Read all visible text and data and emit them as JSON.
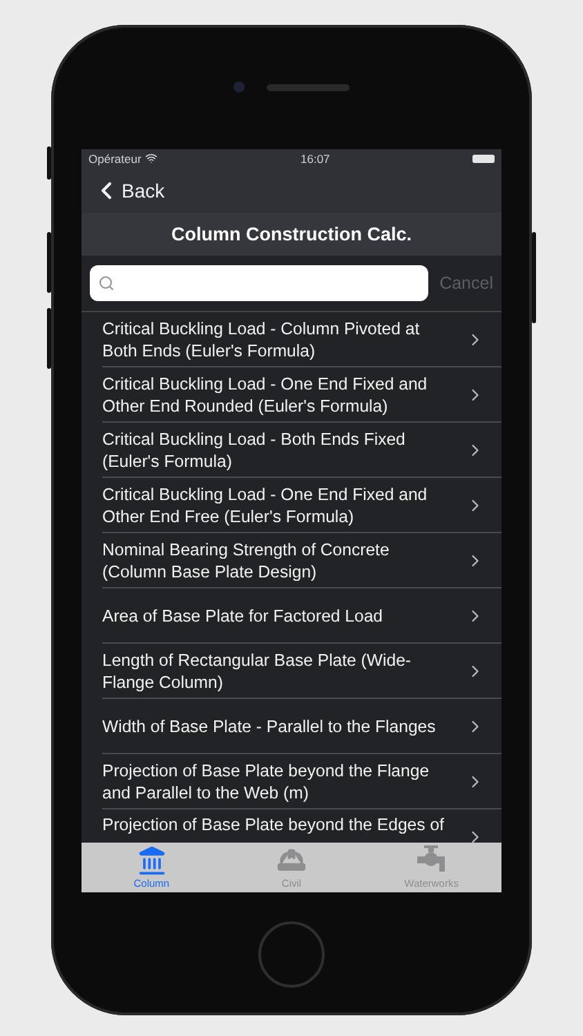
{
  "status_bar": {
    "carrier": "Opérateur",
    "time": "16:07"
  },
  "nav": {
    "back": "Back",
    "title": "Column Construction Calc."
  },
  "search": {
    "cancel": "Cancel"
  },
  "rows": [
    {
      "label": "Critical Buckling Load - Column Pivoted at Both Ends (Euler's Formula)"
    },
    {
      "label": "Critical Buckling Load - One End Fixed and Other End Rounded (Euler's Formula)"
    },
    {
      "label": "Critical Buckling Load - Both Ends Fixed (Euler's Formula)"
    },
    {
      "label": "Critical Buckling Load - One End Fixed and Other End Free (Euler's Formula)"
    },
    {
      "label": "Nominal Bearing Strength of Concrete (Column Base Plate Design)"
    },
    {
      "label": "Area of Base Plate for Factored Load"
    },
    {
      "label": "Length of Rectangular Base Plate (Wide-Flange Column)"
    },
    {
      "label": "Width of Base Plate - Parallel to the Flanges"
    },
    {
      "label": "Projection of Base Plate beyond the Flange and Parallel to the Web (m)"
    },
    {
      "label": "Projection of Base Plate beyond the Edges of"
    }
  ],
  "tabs": [
    {
      "label": "Column",
      "selected": true
    },
    {
      "label": "Civil",
      "selected": false
    },
    {
      "label": "Waterworks",
      "selected": false
    }
  ]
}
